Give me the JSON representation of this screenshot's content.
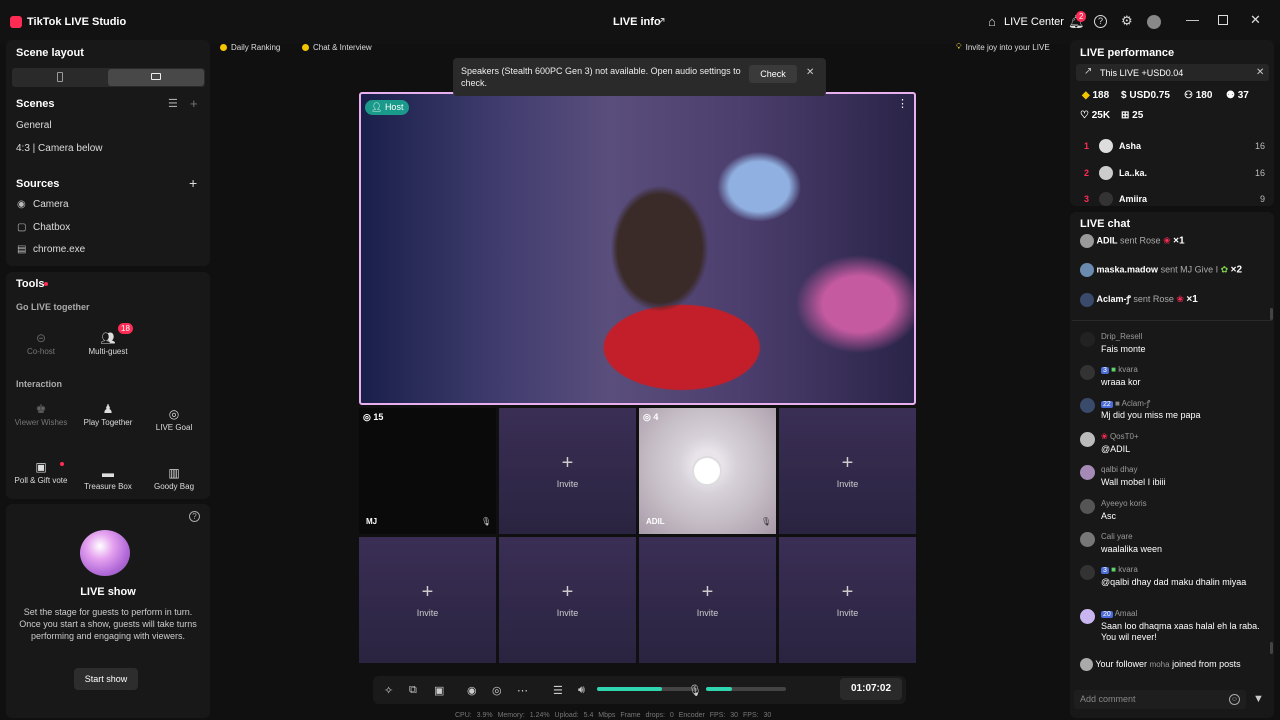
{
  "titlebar": {
    "app_name": "TikTok LIVE Studio",
    "center_title": "LIVE info",
    "live_center": "LIVE Center",
    "notif_count": "2"
  },
  "left": {
    "scene_layout": "Scene layout",
    "scenes_title": "Scenes",
    "scenes": [
      "General",
      "4:3 | Camera below"
    ],
    "sources_title": "Sources",
    "sources": [
      "Camera",
      "Chatbox",
      "chrome.exe"
    ],
    "tools_title": "Tools",
    "go_live_together": "Go LIVE together",
    "cohost": "Co-host",
    "multiguest": "Multi-guest",
    "multiguest_badge": "18",
    "interaction": "Interaction",
    "viewer_wishes": "Viewer Wishes",
    "play_together": "Play Together",
    "live_goal": "LIVE Goal",
    "poll_gift": "Poll & Gift vote",
    "treasure_box": "Treasure Box",
    "goody_bag": "Goody Bag",
    "live_show_title": "LIVE show",
    "live_show_desc": "Set the stage for guests to perform in turn. Once you start a show, guests will take turns performing and engaging with viewers.",
    "start_show": "Start show"
  },
  "center": {
    "daily_ranking": "Daily Ranking",
    "chat_interview": "Chat & Interview",
    "invite_joy": "Invite joy into your LIVE",
    "toast_text": "Speakers (Stealth 600PC Gen 3) not available. Open audio settings to check.",
    "toast_check": "Check",
    "host_label": "Host",
    "guests": [
      {
        "count": "15",
        "name": "MJ"
      },
      {
        "label": "Invite"
      },
      {
        "count": "4",
        "name": "ADIL"
      },
      {
        "label": "Invite"
      },
      {
        "label": "Invite"
      },
      {
        "label": "Invite"
      },
      {
        "label": "Invite"
      },
      {
        "label": "Invite"
      }
    ],
    "speaker_volume": 0.65,
    "mic_volume": 0.33,
    "timer": "01:07:02",
    "stats": "CPU: 3.9%  Memory: 1.24%  Upload: 5.4 Mbps  Frame drops: 0  Encoder FPS: 30  FPS: 30"
  },
  "right": {
    "perf_title": "LIVE performance",
    "perf_banner": "This LIVE +USD0.04",
    "stats": [
      "188",
      "USD0.75",
      "180",
      "37",
      "25K",
      "25"
    ],
    "ranking": [
      {
        "rank": "1",
        "name": "Asha",
        "score": "16"
      },
      {
        "rank": "2",
        "name": "La..ka.",
        "score": "16"
      },
      {
        "rank": "3",
        "name": "Amiira",
        "score": "9"
      }
    ],
    "chat_title": "LIVE chat",
    "gifts": [
      {
        "user": "ADIL",
        "action": "sent Rose",
        "count": "×1"
      },
      {
        "user": "maska.madow",
        "action": "sent MJ Give I",
        "count": "×2"
      },
      {
        "user": "Aclam-ꝭ",
        "action": "sent Rose",
        "count": "×1"
      }
    ],
    "messages": [
      {
        "user": "Drip_Resell",
        "level": "",
        "text": "Fais monte"
      },
      {
        "user": "kvara",
        "level": "3",
        "text": "wraaa kor"
      },
      {
        "user": "Aclam-ꝭ",
        "level": "22",
        "text": "Mj did you miss me papa"
      },
      {
        "user": "QosT0+",
        "level": "",
        "text": "@ADIL"
      },
      {
        "user": "qalbi dhay",
        "level": "",
        "text": "Wall mobel I ibiii"
      },
      {
        "user": "Ayeeyo koris",
        "level": "",
        "text": "Asc"
      },
      {
        "user": "Cali yare",
        "level": "",
        "text": "waalalika ween"
      },
      {
        "user": "kvara",
        "level": "3",
        "text": "@qalbi dhay dad maku dhalin miyaa"
      },
      {
        "user": "Amaal",
        "level": "20",
        "text": "Saan loo dhaqma xaas halal eh la raba. You wil never!"
      }
    ],
    "follower_prefix": "Your follower",
    "follower_name": "moha",
    "follower_suffix": "joined from posts",
    "add_comment": "Add comment"
  }
}
